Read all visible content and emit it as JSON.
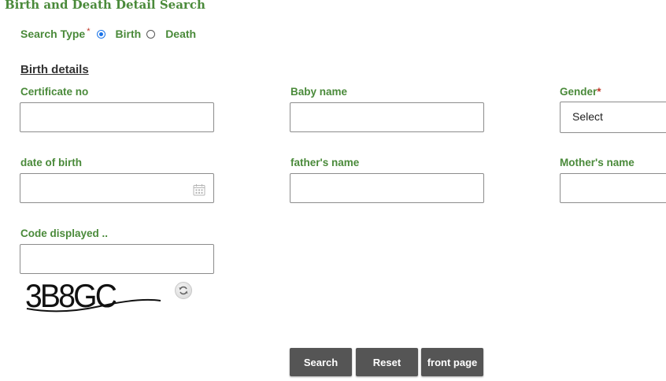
{
  "page": {
    "title": "Birth and Death Detail Search"
  },
  "search_type": {
    "label": "Search Type",
    "required_mark": "*",
    "options": [
      {
        "label": "Birth",
        "selected": true
      },
      {
        "label": "Death",
        "selected": false
      }
    ]
  },
  "birth_details": {
    "heading": "Birth details",
    "fields": {
      "certificate_no": {
        "label": "Certificate no",
        "value": ""
      },
      "baby_name": {
        "label": "Baby name",
        "value": ""
      },
      "gender": {
        "label": "Gender",
        "required_mark": "*",
        "selected": "Select"
      },
      "date_of_birth": {
        "label": "date of birth",
        "value": ""
      },
      "fathers_name": {
        "label": "father's name",
        "value": ""
      },
      "mothers_name": {
        "label": "Mother's name",
        "value": ""
      },
      "code_displayed": {
        "label": "Code displayed ..",
        "value": ""
      }
    }
  },
  "captcha": {
    "text": "3B8GC"
  },
  "buttons": {
    "search": "Search",
    "reset": "Reset",
    "front_page": "front page"
  },
  "colors": {
    "label_green": "#4a8a3a",
    "button_gray": "#555555",
    "required_red": "#c0392b",
    "radio_blue": "#1a73e8"
  },
  "icons": {
    "date_picker": "calendar-icon",
    "captcha_refresh": "refresh-icon"
  }
}
